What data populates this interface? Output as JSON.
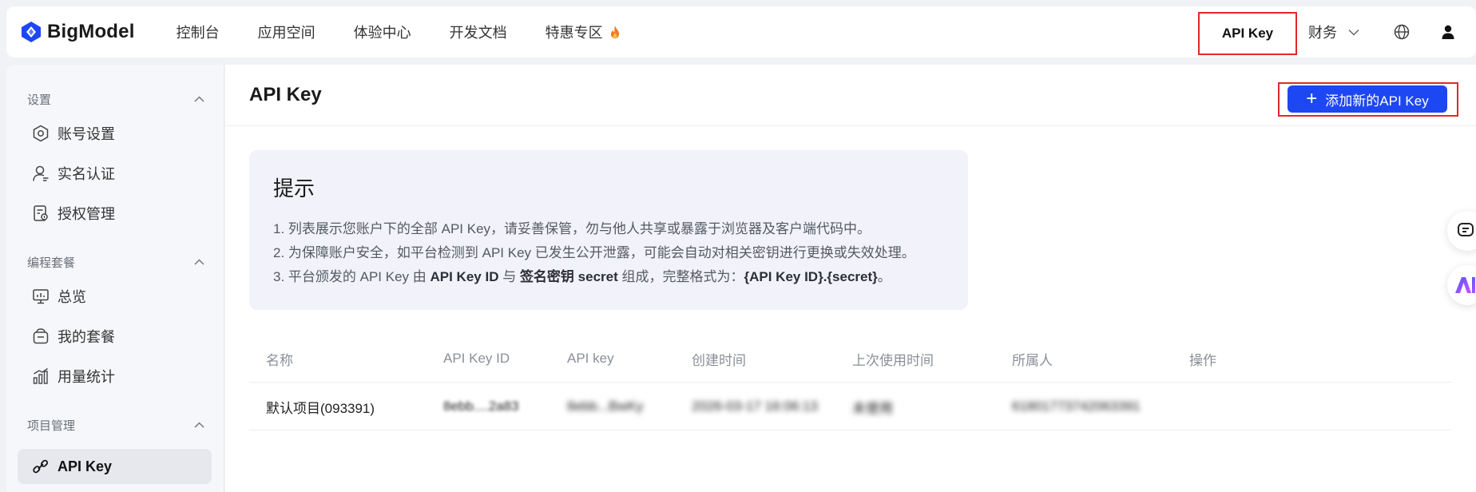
{
  "brand": {
    "name": "BigModel"
  },
  "nav": {
    "links": [
      {
        "label": "控制台"
      },
      {
        "label": "应用空间"
      },
      {
        "label": "体验中心"
      },
      {
        "label": "开发文档"
      },
      {
        "label": "特惠专区"
      }
    ],
    "apikey": "API Key",
    "finance": "财务"
  },
  "sidebar": {
    "sections": [
      {
        "title": "设置",
        "items": [
          "账号设置",
          "实名认证",
          "授权管理"
        ]
      },
      {
        "title": "编程套餐",
        "items": [
          "总览",
          "我的套餐",
          "用量统计"
        ]
      },
      {
        "title": "项目管理",
        "items": [
          "API Key"
        ]
      }
    ]
  },
  "page": {
    "title": "API Key",
    "add_button": "添加新的API Key"
  },
  "tip": {
    "title": "提示",
    "line1": "1. 列表展示您账户下的全部 API Key，请妥善保管，勿与他人共享或暴露于浏览器及客户端代码中。",
    "line2": "2. 为保障账户安全，如平台检测到 API Key 已发生公开泄露，可能会自动对相关密钥进行更换或失效处理。",
    "line3_a": "3. 平台颁发的 API Key 由 ",
    "line3_b": "API Key ID",
    "line3_c": " 与 ",
    "line3_d": "签名密钥 secret",
    "line3_e": " 组成，完整格式为：",
    "line3_f": "{API Key ID}.{secret}",
    "line3_g": "。"
  },
  "table": {
    "headers": [
      "名称",
      "API Key ID",
      "API key",
      "创建时间",
      "上次使用时间",
      "所属人",
      "操作"
    ],
    "rows": [
      {
        "name": "默认项目(093391)",
        "key_id": "8ebb....2a83",
        "key": "8ebb...BwKy",
        "created": "2026-03-17 16:06:13",
        "last_used": "未使用",
        "owner": "61801773742063391"
      }
    ]
  },
  "colors": {
    "primary": "#1d47f2",
    "highlight": "#e22828",
    "fire": "#f07a1a"
  }
}
